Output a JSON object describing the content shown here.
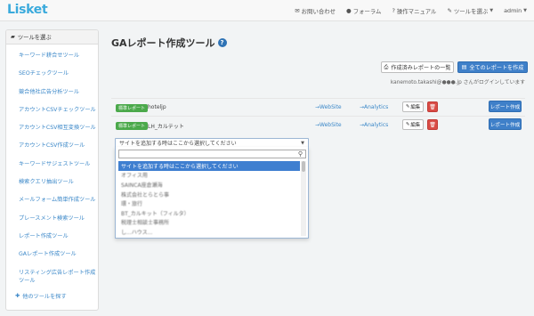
{
  "app": {
    "logo": "Lisket"
  },
  "nav": {
    "contact": "お問い合わせ",
    "forum": "フォーラム",
    "manual": "操作マニュアル",
    "tools": "ツールを選ぶ",
    "user": "admin"
  },
  "sidebar": {
    "heading": "ツールを選ぶ",
    "items": [
      {
        "label": "キーワード耕合せツール"
      },
      {
        "label": "SEOチェックツール"
      },
      {
        "label": "競合他社広告分析ツール"
      },
      {
        "label": "アカウントCSVチェックツール"
      },
      {
        "label": "アカウントCSV相互変換ツール"
      },
      {
        "label": "アカウントCSV作成ツール"
      },
      {
        "label": "キーワードサジェストツール"
      },
      {
        "label": "検索クエリ抽出ツール"
      },
      {
        "label": "メールフォーム簡単作成ツール"
      },
      {
        "label": "プレースメント検索ツール"
      },
      {
        "label": "レポート作成ツール"
      },
      {
        "label": "GAレポート作成ツール"
      },
      {
        "label": "リスティング広告レポート作成ツール"
      }
    ],
    "more": "他のツールを探す"
  },
  "main": {
    "title": "GAレポート作成ツール",
    "help_icon": "?",
    "list_button": "作成済みレポートの一覧",
    "create_all_button": "全てのレポートを作成",
    "login_message": "kanemoto.takashi@●●●.jp さんがログインしています",
    "rows": [
      {
        "badge": "標準レポート",
        "site": "hoteljp",
        "website": "→WebSite",
        "analytics": "→Analytics",
        "edit": "編集",
        "report": "レポート作成"
      },
      {
        "badge": "標準レポート",
        "site": "LH_カルテット",
        "website": "→WebSite",
        "analytics": "→Analytics",
        "edit": "編集",
        "report": "レポート作成"
      }
    ]
  },
  "select": {
    "value": "サイトを追加する時はここから選択してください",
    "search_value": "",
    "options": [
      "サイトを追加する時はここから選択してください",
      "オフィス用",
      "SAINCA座倉瀬海",
      "株式会社とらとら事",
      "環・旅行",
      "BT_カルキット（フィルタ）",
      "税理士相談士事務所",
      "し...ハウス..."
    ]
  },
  "colors": {
    "accent": "#3f80c9",
    "logo": "#3aaadc",
    "badge": "#4ba94b",
    "danger": "#d94c46"
  }
}
